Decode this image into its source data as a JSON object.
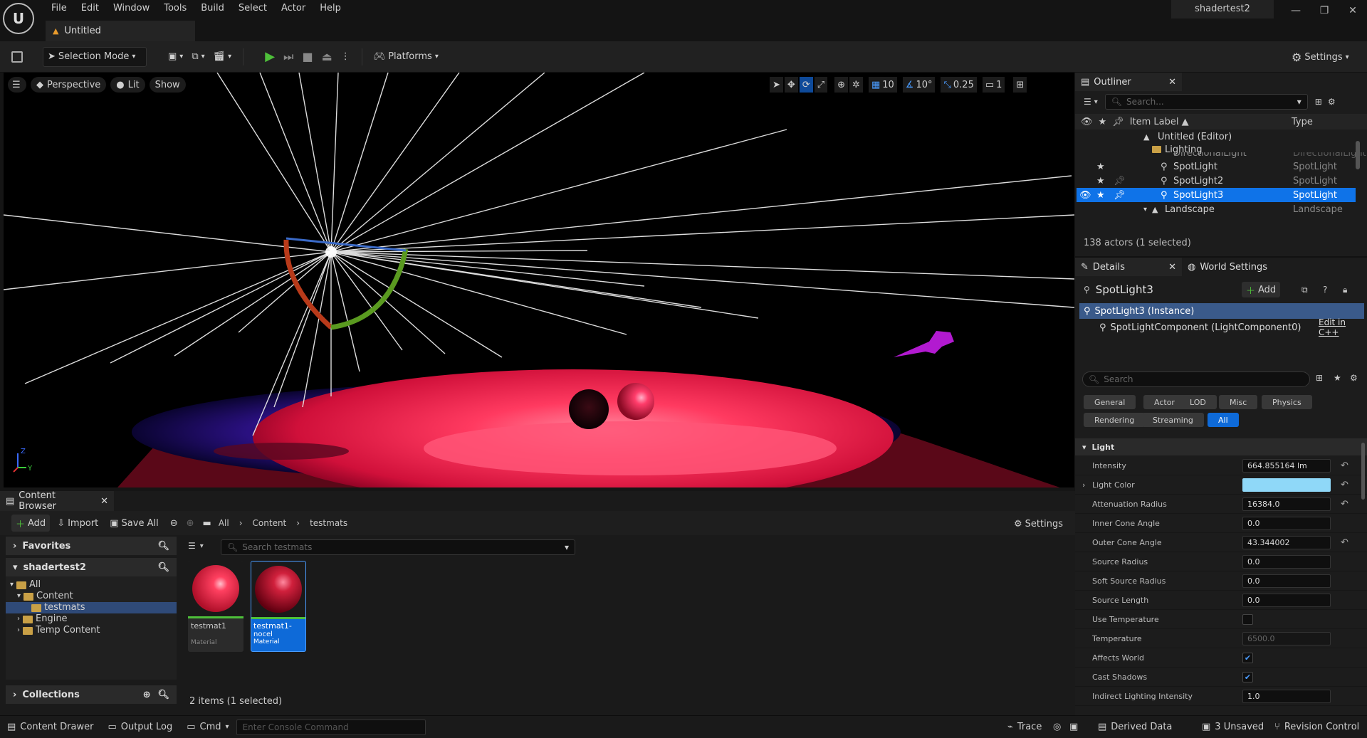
{
  "menu": [
    "File",
    "Edit",
    "Window",
    "Tools",
    "Build",
    "Select",
    "Actor",
    "Help"
  ],
  "doc_tab": "Untitled",
  "project_name": "shadertest2",
  "toolbar": {
    "selection_mode": "Selection Mode",
    "platforms": "Platforms",
    "settings": "Settings"
  },
  "viewport": {
    "perspective": "Perspective",
    "lit": "Lit",
    "show": "Show",
    "grid_snap": "10",
    "rot_snap": "10°",
    "scale_snap": "0.25",
    "camera_speed": "1",
    "axis_z": "Z",
    "axis_y": "Y"
  },
  "content_browser": {
    "tab": "Content Browser",
    "add": "Add",
    "import": "Import",
    "save_all": "Save All",
    "path": [
      "All",
      "Content",
      "testmats"
    ],
    "settings": "Settings",
    "favorites": "Favorites",
    "project": "shadertest2",
    "tree": [
      "All",
      "Content",
      "testmats",
      "Engine",
      "Temp Content"
    ],
    "collections": "Collections",
    "search_placeholder": "Search testmats",
    "assets": [
      {
        "name": "testmat1",
        "type": "Material"
      },
      {
        "name": "testmat1-",
        "name2": "nocel",
        "type": "Material"
      }
    ],
    "count": "2 items (1 selected)"
  },
  "outliner": {
    "tab": "Outliner",
    "search_placeholder": "Search...",
    "col_label": "Item Label ▲",
    "col_type": "Type",
    "rows": [
      {
        "label": "Untitled (Editor)",
        "type": ""
      },
      {
        "label": "Lighting",
        "type": ""
      },
      {
        "label": "DirectionalLight",
        "type": "DirectionalLight"
      },
      {
        "label": "SpotLight",
        "type": "SpotLight"
      },
      {
        "label": "SpotLight2",
        "type": "SpotLight"
      },
      {
        "label": "SpotLight3",
        "type": "SpotLight"
      },
      {
        "label": "Landscape",
        "type": "Landscape"
      }
    ],
    "actor_count": "138 actors (1 selected)"
  },
  "details": {
    "tab": "Details",
    "world_tab": "World Settings",
    "actor_name": "SpotLight3",
    "add": "Add",
    "instance": "SpotLight3 (Instance)",
    "component": "SpotLightComponent (LightComponent0)",
    "edit_cpp": "Edit in C++",
    "search_placeholder": "Search",
    "categories_row1": [
      "General",
      "Actor",
      "LOD",
      "Misc",
      "Physics"
    ],
    "categories_row2": [
      "Rendering",
      "Streaming",
      "All"
    ],
    "section": "Light",
    "props": [
      {
        "name": "Intensity",
        "value": "664.855164 lm"
      },
      {
        "name": "Light Color",
        "value": ""
      },
      {
        "name": "Attenuation Radius",
        "value": "16384.0"
      },
      {
        "name": "Inner Cone Angle",
        "value": "0.0"
      },
      {
        "name": "Outer Cone Angle",
        "value": "43.344002"
      },
      {
        "name": "Source Radius",
        "value": "0.0"
      },
      {
        "name": "Soft Source Radius",
        "value": "0.0"
      },
      {
        "name": "Source Length",
        "value": "0.0"
      },
      {
        "name": "Use Temperature",
        "value": ""
      },
      {
        "name": "Temperature",
        "value": "6500.0"
      },
      {
        "name": "Affects World",
        "value": ""
      },
      {
        "name": "Cast Shadows",
        "value": ""
      },
      {
        "name": "Indirect Lighting Intensity",
        "value": "1.0"
      }
    ],
    "light_color_hex": "#8fd8f8"
  },
  "status": {
    "content_drawer": "Content Drawer",
    "output_log": "Output Log",
    "cmd": "Cmd",
    "console_placeholder": "Enter Console Command",
    "trace": "Trace",
    "derived_data": "Derived Data",
    "unsaved": "3 Unsaved",
    "revision": "Revision Control"
  },
  "colors": {
    "accent": "#0e6ad8",
    "selection": "#0f73e8",
    "bg": "#151515"
  }
}
